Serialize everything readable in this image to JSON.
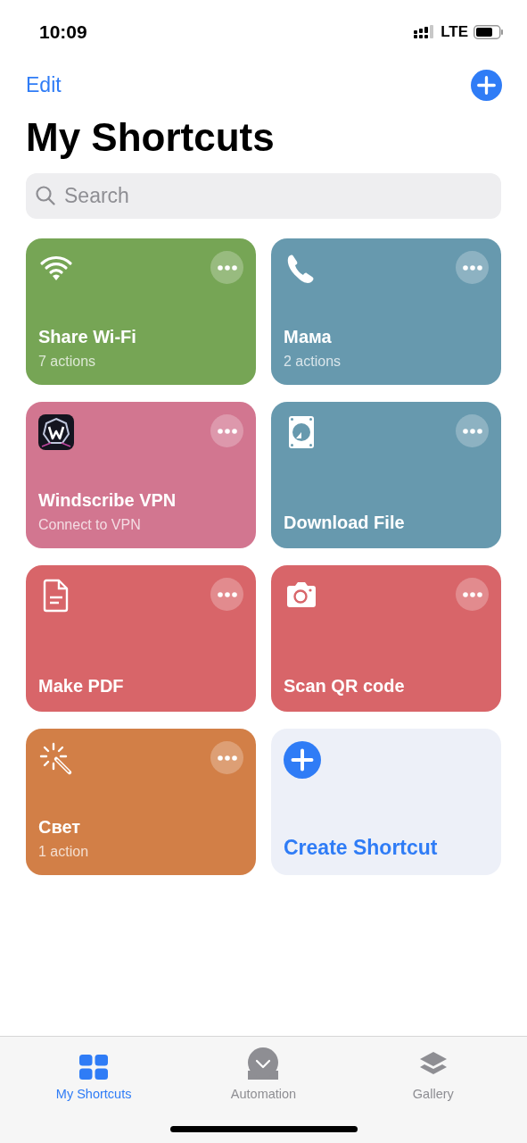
{
  "status_bar": {
    "time": "10:09",
    "network": "LTE"
  },
  "nav": {
    "edit": "Edit"
  },
  "title": "My Shortcuts",
  "search": {
    "placeholder": "Search"
  },
  "shortcuts": [
    {
      "kind": "shortcut",
      "color": "#76a555",
      "title": "Share Wi-Fi",
      "subtitle": "7 actions"
    },
    {
      "kind": "shortcut",
      "color": "#6799ae",
      "title": "Мама",
      "subtitle": "2 actions"
    },
    {
      "kind": "shortcut",
      "color": "#d27690",
      "title": "Windscribe VPN",
      "subtitle": "Connect to VPN"
    },
    {
      "kind": "shortcut",
      "color": "#6799ae",
      "title": "Download File"
    },
    {
      "kind": "shortcut",
      "color": "#d86569",
      "title": "Make PDF"
    },
    {
      "kind": "shortcut",
      "color": "#d86569",
      "title": "Scan QR code"
    },
    {
      "kind": "shortcut",
      "color": "#d27f47",
      "title": "Свет",
      "subtitle": "1 action"
    },
    {
      "kind": "create",
      "title": "Create Shortcut"
    }
  ],
  "tabs": [
    {
      "label": "My Shortcuts",
      "selected": true
    },
    {
      "label": "Automation",
      "selected": false
    },
    {
      "label": "Gallery",
      "selected": false
    }
  ]
}
